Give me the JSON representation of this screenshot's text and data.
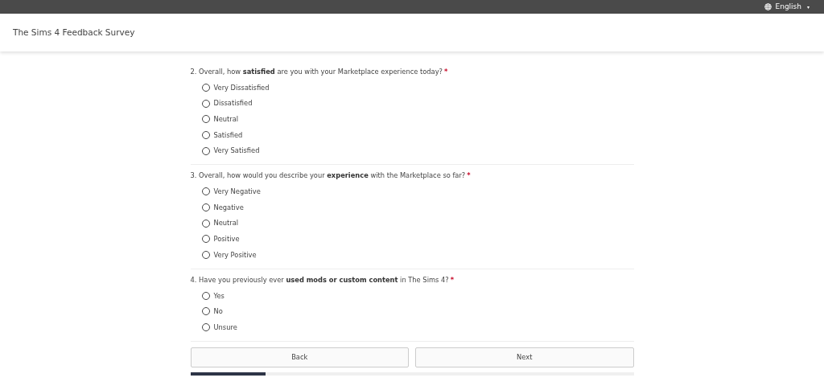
{
  "top_bar": {
    "language": "English",
    "caret": "▾"
  },
  "header": {
    "title": "The Sims 4 Feedback Survey"
  },
  "questions": [
    {
      "text": "2. Overall, how **satisfied** are you with your Marketplace experience today?",
      "required_mark": "*",
      "options": [
        {
          "label": "Very Dissatisfied",
          "selected": false
        },
        {
          "label": "Dissatisfied",
          "selected": false
        },
        {
          "label": "Neutral",
          "selected": false
        },
        {
          "label": "Satisfied",
          "selected": false
        },
        {
          "label": "Very Satisfied",
          "selected": false
        }
      ]
    },
    {
      "text": "3. Overall, how would you describe your **experience** with the Marketplace so far?",
      "required_mark": "*",
      "options": [
        {
          "label": "Very Negative",
          "selected": false
        },
        {
          "label": "Negative",
          "selected": false
        },
        {
          "label": "Neutral",
          "selected": false
        },
        {
          "label": "Positive",
          "selected": false
        },
        {
          "label": "Very Positive",
          "selected": false
        }
      ]
    },
    {
      "text": "4. Have you previously ever **used mods or custom content** in The Sims 4?",
      "required_mark": "*",
      "options": [
        {
          "label": "Yes",
          "selected": false
        },
        {
          "label": "No",
          "selected": false
        },
        {
          "label": "Unsure",
          "selected": false
        }
      ]
    }
  ],
  "buttons": [
    {
      "label": "Back"
    },
    {
      "label": "Next"
    }
  ],
  "progress": {
    "level": 0.17
  }
}
